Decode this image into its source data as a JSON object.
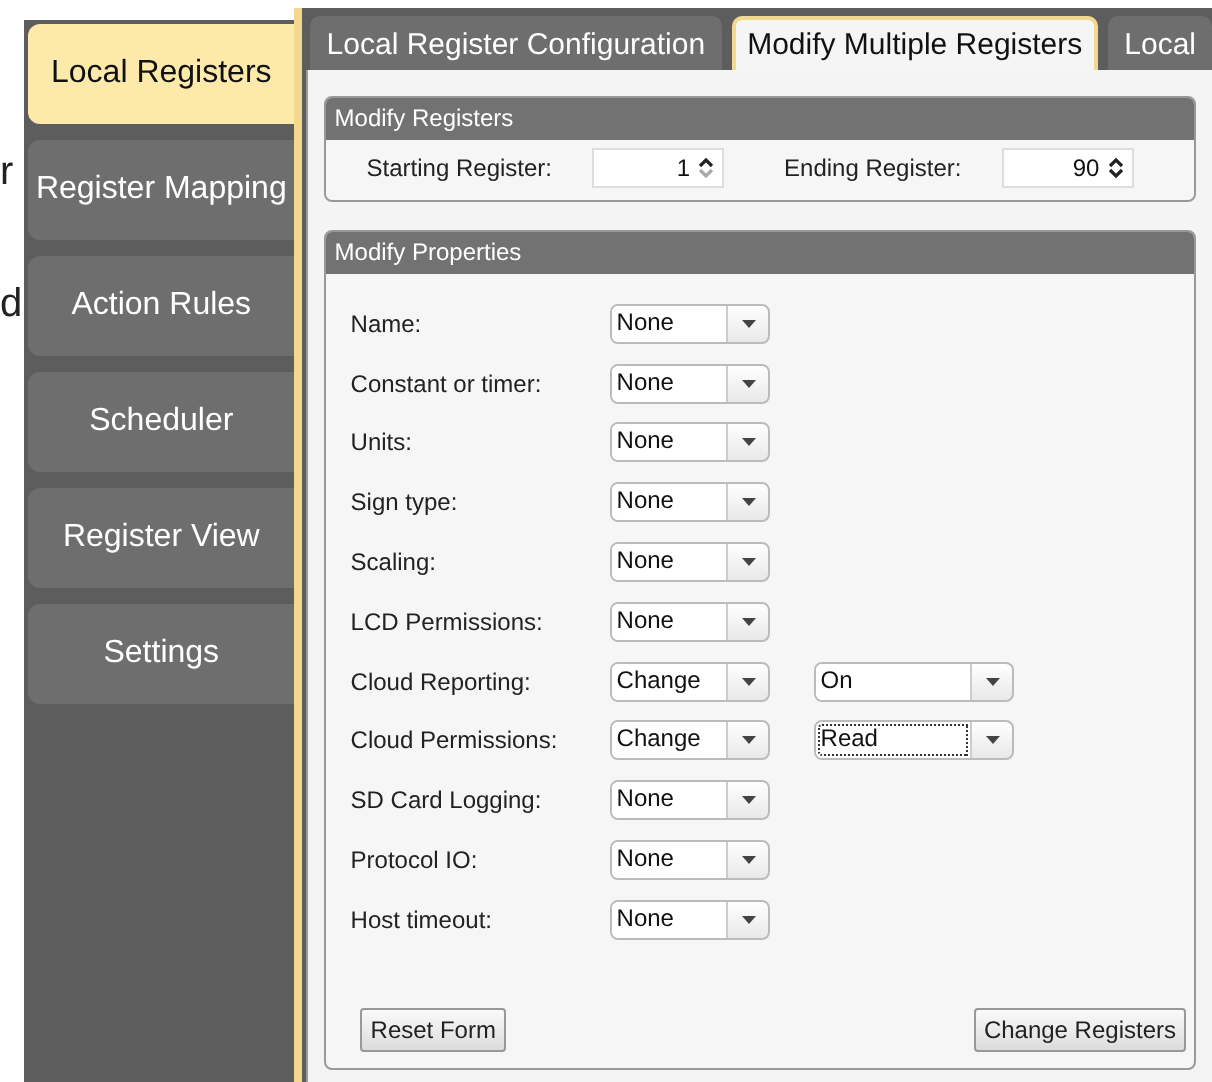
{
  "page_fragments": [
    "r",
    "d"
  ],
  "sidebar": {
    "items": [
      {
        "label": "Local Registers",
        "selected": true
      },
      {
        "label": "Register Mapping",
        "selected": false
      },
      {
        "label": "Action Rules",
        "selected": false
      },
      {
        "label": "Scheduler",
        "selected": false
      },
      {
        "label": "Register View",
        "selected": false
      },
      {
        "label": "Settings",
        "selected": false
      }
    ]
  },
  "tabs": [
    {
      "label": "Local Register Configuration",
      "selected": false
    },
    {
      "label": "Modify Multiple Registers",
      "selected": true
    },
    {
      "label": "Local",
      "selected": false
    }
  ],
  "modify_registers": {
    "title": "Modify Registers",
    "starting": {
      "label": "Starting Register:",
      "value": "1"
    },
    "ending": {
      "label": "Ending Register:",
      "value": "90"
    }
  },
  "modify_properties": {
    "title": "Modify Properties",
    "rows": [
      {
        "label": "Name:",
        "value": "None"
      },
      {
        "label": "Constant or timer:",
        "value": "None"
      },
      {
        "label": "Units:",
        "value": "None"
      },
      {
        "label": "Sign type:",
        "value": "None"
      },
      {
        "label": "Scaling:",
        "value": "None"
      },
      {
        "label": "LCD Permissions:",
        "value": "None"
      },
      {
        "label": "Cloud Reporting:",
        "value": "Change",
        "extra": {
          "value": "On",
          "focused": false
        }
      },
      {
        "label": "Cloud Permissions:",
        "value": "Change",
        "extra": {
          "value": "Read",
          "focused": true
        }
      },
      {
        "label": "SD Card Logging:",
        "value": "None"
      },
      {
        "label": "Protocol IO:",
        "value": "None"
      },
      {
        "label": "Host timeout:",
        "value": "None"
      }
    ],
    "buttons": [
      "Reset Form",
      "Change Registers"
    ]
  }
}
